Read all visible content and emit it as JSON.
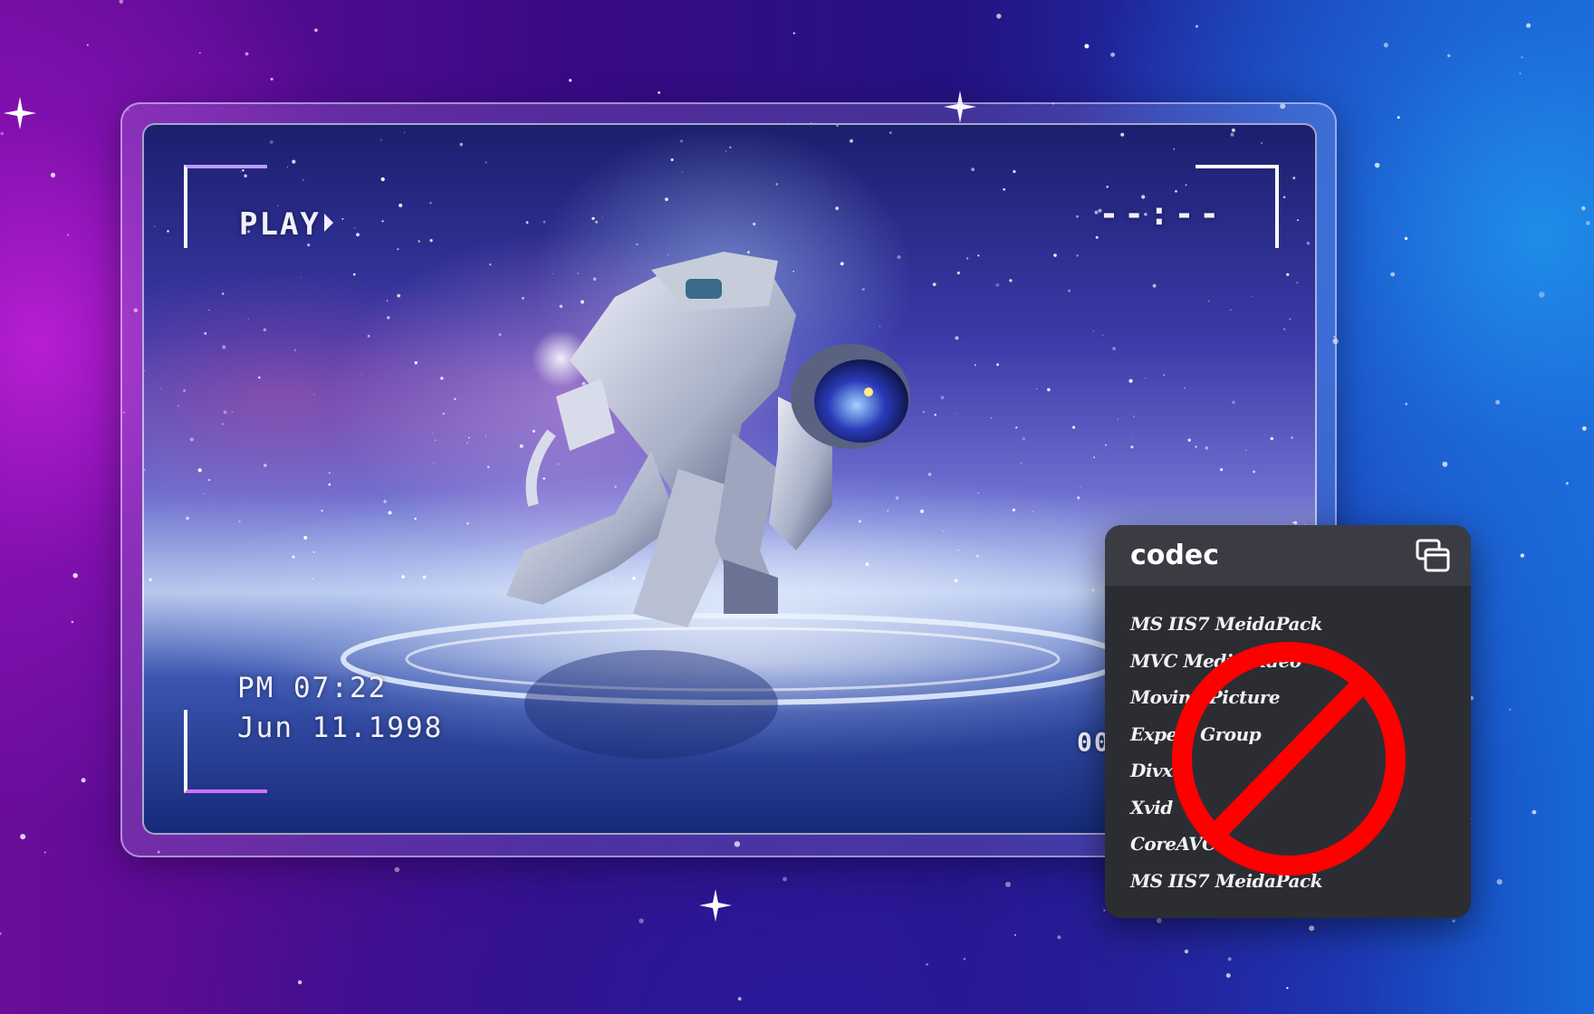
{
  "viewfinder": {
    "mode_label": "PLAY",
    "timer": "--:--",
    "time": "PM 07:22",
    "date": "Jun 11.1998",
    "counter": "00:0"
  },
  "codec_panel": {
    "title": "codec",
    "items": [
      "MS IIS7 MeidaPack",
      "MVC Media video",
      "Moving Picture",
      "Expert Group",
      "Divx",
      "Xvid",
      "CoreAVC",
      "MS IIS7 MeidaPack"
    ],
    "icons": {
      "window": "window-restore-icon",
      "prohibition": "prohibition-sign-icon",
      "play": "play-triangle-icon"
    }
  },
  "colors": {
    "prohibition_red": "#ff0000",
    "panel_bg": "#2c2d33",
    "panel_header_bg": "#3b3c43",
    "bracket_accent": "#b79cff"
  }
}
